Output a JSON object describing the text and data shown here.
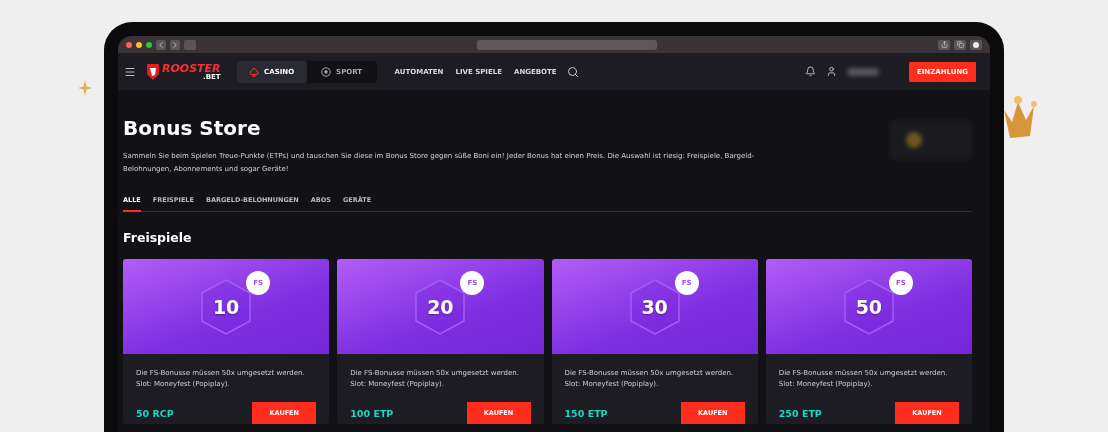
{
  "brand": {
    "name": "ROOSTER",
    "suffix": ".BET"
  },
  "verticals": [
    {
      "label": "CASINO",
      "selected": true,
      "kind": "casino"
    },
    {
      "label": "SPORT",
      "selected": false,
      "kind": "sport"
    }
  ],
  "nav_links": [
    "AUTOMATEN",
    "LIVE SPIELE",
    "ANGEBOTE"
  ],
  "deposit_button": "EINZAHLUNG",
  "page": {
    "title": "Bonus Store",
    "intro": "Sammeln Sie beim Spielen Treue-Punkte (ETPs) und tauschen Sie diese im Bonus Store gegen süße Boni ein! Jeder Bonus hat einen Preis. Die Auswahl ist riesig: Freispiele, Bargeld-Belohnungen, Abonnements und sogar Geräte!"
  },
  "tabs": [
    {
      "label": "ALLE",
      "selected": true
    },
    {
      "label": "FREISPIELE",
      "selected": false
    },
    {
      "label": "BARGELD-BELOHNUNGEN",
      "selected": false
    },
    {
      "label": "ABOS",
      "selected": false
    },
    {
      "label": "GERÄTE",
      "selected": false
    }
  ],
  "section_title": "Freispiele",
  "cards": [
    {
      "amount": "10",
      "badge": "FS",
      "description": "Die FS-Bonusse müssen 50x umgesetzt werden. Slot: Moneyfest (Popiplay).",
      "price": "50 RCP",
      "button": "KAUFEN"
    },
    {
      "amount": "20",
      "badge": "FS",
      "description": "Die FS-Bonusse müssen 50x umgesetzt werden. Slot: Moneyfest (Popiplay).",
      "price": "100 ETP",
      "button": "KAUFEN"
    },
    {
      "amount": "30",
      "badge": "FS",
      "description": "Die FS-Bonusse müssen 50x umgesetzt werden. Slot: Moneyfest (Popiplay).",
      "price": "150 ETP",
      "button": "KAUFEN"
    },
    {
      "amount": "50",
      "badge": "FS",
      "description": "Die FS-Bonusse müssen 50x umgesetzt werden. Slot: Moneyfest (Popiplay).",
      "price": "250 ETP",
      "button": "KAUFEN"
    }
  ]
}
